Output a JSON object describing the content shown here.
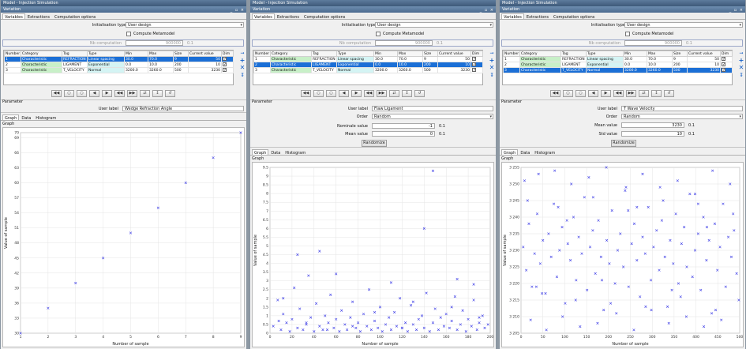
{
  "app_title": "Model - Injection Simulation",
  "window_title": "Variation",
  "window_controls": "_ ▫ ×",
  "tabs": [
    "Variables",
    "Extractions",
    "Computation options"
  ],
  "init_label": "Initialisation type",
  "init_value": "User design",
  "compute_metamodel": "Compute Metamodel",
  "nb_label": "Nb computation",
  "nb_value": "900000",
  "nb_unit": "0.1",
  "columns": [
    "Number",
    "Category",
    "Tag",
    "Type",
    "Min",
    "Max",
    "Size",
    "Current value",
    "Dim"
  ],
  "rows": [
    {
      "num": "1",
      "cat": "Characteristic",
      "tag": "REFRACTION",
      "type": "Linear spacing",
      "min": "30.0",
      "max": "70.0",
      "size": "9",
      "cur": "50"
    },
    {
      "num": "2",
      "cat": "Characteristic",
      "tag": "LIGAMENT",
      "type": "Exponential",
      "min": "0.0",
      "max": "10.0",
      "size": "200",
      "cur": "10"
    },
    {
      "num": "3",
      "cat": "Characteristic",
      "tag": "T_VELOCITY",
      "type": "Normal",
      "min": "3200.0",
      "max": "3260.0",
      "size": "500",
      "cur": "3230"
    }
  ],
  "parameter_label": "Parameter",
  "user_label": "User label",
  "order_label": "Order",
  "order_value": "Random",
  "graph_tabs": [
    "Graph",
    "Data",
    "Histogram"
  ],
  "graph_label": "Graph",
  "randomize": "Randomize",
  "panels": [
    {
      "user_label_value": "Wedge Refraction Angle",
      "chart_data": {
        "type": "scatter",
        "x": [
          1,
          2,
          3,
          4,
          5,
          6,
          7,
          8,
          9
        ],
        "y": [
          30,
          35,
          40,
          45,
          50,
          55,
          60,
          65,
          70
        ],
        "xlabel": "Number of sample",
        "ylabel": "Value of sample",
        "xlim": [
          1,
          9
        ],
        "ylim": [
          30,
          70
        ],
        "xticks": [
          "1",
          "2",
          "3",
          "4",
          "5",
          "6",
          "7",
          "8",
          "9"
        ],
        "yticks": [
          "30",
          "33",
          "36",
          "39",
          "42",
          "45",
          "48",
          "51",
          "54",
          "57",
          "60",
          "63",
          "66",
          "69",
          "70"
        ],
        "marker": "x",
        "color": "#3a3ae6",
        "grid": true
      }
    },
    {
      "user_label_value": "Flaw Ligament",
      "nominal_label": "Nominale value",
      "nominal_value": "-1",
      "mean_label": "Mean value",
      "mean_value": "0",
      "unit": "0.1",
      "chart_data": {
        "type": "scatter",
        "x": [
          3,
          7,
          10,
          12,
          15,
          18,
          20,
          22,
          25,
          27,
          30,
          33,
          35,
          37,
          40,
          42,
          45,
          48,
          50,
          53,
          55,
          58,
          60,
          63,
          65,
          68,
          70,
          73,
          75,
          78,
          80,
          82,
          85,
          88,
          90,
          92,
          95,
          98,
          100,
          102,
          105,
          108,
          110,
          113,
          115,
          118,
          120,
          123,
          125,
          128,
          130,
          133,
          135,
          138,
          140,
          142,
          145,
          148,
          150,
          153,
          155,
          158,
          160,
          163,
          165,
          168,
          170,
          173,
          175,
          178,
          180,
          183,
          185,
          188,
          190,
          193,
          195,
          198,
          25,
          45,
          148,
          60,
          110,
          170,
          8,
          95,
          130,
          185,
          52,
          75,
          140,
          165,
          12,
          190,
          33,
          120
        ],
        "y": [
          0.4,
          1.9,
          0.2,
          1.1,
          0.6,
          0.1,
          0.8,
          2.6,
          0.3,
          1.4,
          0.2,
          0.5,
          3.3,
          0.9,
          0.1,
          1.7,
          0.4,
          0.2,
          1.0,
          0.6,
          2.2,
          0.3,
          0.8,
          0.1,
          1.3,
          0.5,
          0.2,
          0.9,
          1.8,
          0.3,
          0.6,
          0.1,
          1.1,
          0.4,
          2.5,
          0.2,
          0.7,
          0.3,
          1.5,
          0.1,
          0.5,
          0.9,
          0.2,
          1.2,
          0.4,
          2.0,
          0.3,
          0.6,
          0.1,
          1.6,
          0.5,
          0.2,
          0.8,
          1.0,
          0.3,
          2.3,
          0.1,
          0.6,
          1.4,
          0.2,
          0.9,
          0.4,
          1.1,
          0.3,
          0.7,
          2.1,
          0.2,
          0.5,
          1.3,
          0.1,
          0.8,
          0.4,
          1.9,
          0.2,
          0.6,
          1.0,
          0.3,
          0.5,
          4.5,
          4.7,
          9.3,
          3.4,
          2.9,
          3.1,
          0.7,
          1.2,
          1.8,
          2.8,
          0.2,
          0.4,
          6.0,
          1.5,
          2.0,
          0.9,
          0.6,
          0.3
        ],
        "xlabel": "Number of sample",
        "ylabel": "Value of sample",
        "xlim": [
          0,
          200
        ],
        "ylim": [
          0,
          9.5
        ],
        "xticks": [
          "0",
          "20",
          "40",
          "60",
          "80",
          "100",
          "120",
          "140",
          "160",
          "180",
          "200"
        ],
        "yticks": [
          "0",
          "0.5",
          "1",
          "1.5",
          "2",
          "2.5",
          "3",
          "3.5",
          "4",
          "4.5",
          "5",
          "5.5",
          "6",
          "6.5",
          "7",
          "7.5",
          "8",
          "8.5",
          "9",
          "9.5"
        ],
        "marker": "x",
        "color": "#3a3ae6",
        "grid": true
      }
    },
    {
      "user_label_value": "T Wave Velocity",
      "mean_label": "Mean value",
      "mean_value": "3230",
      "std_label": "Std value",
      "std_value": "10",
      "unit": "0.1",
      "chart_data": {
        "type": "scatter",
        "x": [
          5,
          12,
          18,
          25,
          31,
          37,
          44,
          50,
          56,
          63,
          69,
          75,
          82,
          88,
          94,
          101,
          107,
          113,
          120,
          126,
          132,
          139,
          145,
          151,
          158,
          164,
          170,
          177,
          183,
          189,
          196,
          202,
          208,
          215,
          221,
          227,
          234,
          240,
          246,
          253,
          259,
          265,
          272,
          278,
          284,
          291,
          297,
          303,
          310,
          316,
          322,
          329,
          335,
          341,
          348,
          354,
          360,
          367,
          373,
          379,
          386,
          392,
          398,
          405,
          411,
          417,
          424,
          430,
          436,
          443,
          449,
          455,
          462,
          468,
          474,
          481,
          487,
          493,
          8,
          22,
          40,
          58,
          77,
          95,
          115,
          135,
          155,
          175,
          195,
          218,
          238,
          258,
          278,
          298,
          318,
          338,
          358,
          378,
          398,
          418,
          438,
          458,
          478,
          498,
          15,
          48,
          85,
          125,
          165,
          205,
          245,
          285,
          325,
          365,
          405,
          445,
          485,
          35,
          105,
          185,
          265,
          345,
          425
        ],
        "y": [
          3231,
          3224,
          3238,
          3219,
          3229,
          3241,
          3226,
          3233,
          3217,
          3235,
          3228,
          3244,
          3222,
          3230,
          3237,
          3214,
          3232,
          3227,
          3240,
          3221,
          3234,
          3229,
          3246,
          3218,
          3231,
          3236,
          3223,
          3239,
          3228,
          3212,
          3233,
          3226,
          3242,
          3220,
          3230,
          3235,
          3225,
          3249,
          3219,
          3232,
          3238,
          3227,
          3216,
          3234,
          3229,
          3243,
          3221,
          3231,
          3236,
          3224,
          3239,
          3228,
          3213,
          3233,
          3226,
          3241,
          3220,
          3232,
          3237,
          3225,
          3247,
          3222,
          3230,
          3235,
          3218,
          3240,
          3227,
          3233,
          3211,
          3238,
          3224,
          3231,
          3244,
          3219,
          3234,
          3228,
          3236,
          3223,
          3251,
          3209,
          3253,
          3206,
          3254,
          3210,
          3250,
          3207,
          3252,
          3208,
          3255,
          3211,
          3248,
          3206,
          3253,
          3212,
          3249,
          3208,
          3251,
          3210,
          3247,
          3207,
          3254,
          3209,
          3250,
          3215,
          3245,
          3217,
          3243,
          3215,
          3246,
          3214,
          3242,
          3213,
          3245,
          3216,
          3244,
          3212,
          3241,
          3219,
          3239,
          3221,
          3243,
          3218,
          3237
        ],
        "xlabel": "Number of sample",
        "ylabel": "Value of sample",
        "xlim": [
          0,
          500
        ],
        "ylim": [
          3205,
          3255
        ],
        "xticks": [
          "0",
          "50",
          "100",
          "150",
          "200",
          "250",
          "300",
          "350",
          "400",
          "450",
          "500"
        ],
        "yticks": [
          "3 205",
          "3 210",
          "3 215",
          "3 220",
          "3 225",
          "3 230",
          "3 235",
          "3 240",
          "3 245",
          "3 250",
          "3 255"
        ],
        "marker": "x",
        "color": "#3a3ae6",
        "grid": true
      }
    }
  ]
}
